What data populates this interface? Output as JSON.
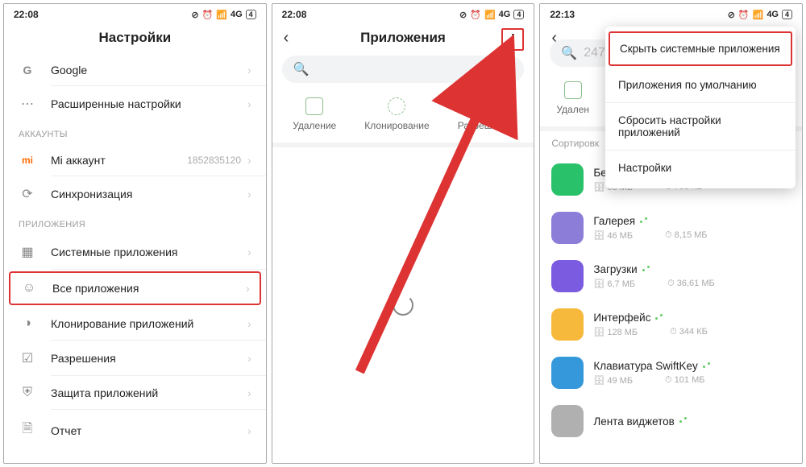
{
  "screen1": {
    "time": "22:08",
    "net": "4G",
    "batt": "4",
    "title": "Настройки",
    "rows": {
      "google": "Google",
      "advanced": "Расширенные настройки"
    },
    "section_accounts": "АККАУНТЫ",
    "mi_account": "Mi аккаунт",
    "mi_id": "1852835120",
    "sync": "Синхронизация",
    "section_apps": "ПРИЛОЖЕНИЯ",
    "sys_apps": "Системные приложения",
    "all_apps": "Все приложения",
    "clone_apps": "Клонирование приложений",
    "permissions": "Разрешения",
    "app_protect": "Защита приложений",
    "report": "Отчет"
  },
  "screen2": {
    "time": "22:08",
    "net": "4G",
    "batt": "4",
    "title": "Приложения",
    "actions": {
      "delete": "Удаление",
      "clone": "Клонирование",
      "perm": "Разрешения"
    }
  },
  "screen3": {
    "time": "22:13",
    "net": "4G",
    "batt": "4",
    "search_count": "247",
    "action_delete": "Удален",
    "sort_label": "Сортировк",
    "menu": {
      "hide_sys": "Скрыть системные приложения",
      "default_apps": "Приложения по умолчанию",
      "reset": "Сбросить настройки приложений",
      "settings": "Настройки"
    },
    "apps": [
      {
        "name": "Безопасность",
        "size": "68 МБ",
        "cache": "799 КБ",
        "iconClass": "bg-green"
      },
      {
        "name": "Галерея",
        "size": "46 МБ",
        "cache": "8,15 МБ",
        "iconClass": "bg-purple"
      },
      {
        "name": "Загрузки",
        "size": "6,7 МБ",
        "cache": "36,61 МБ",
        "iconClass": "bg-violet"
      },
      {
        "name": "Интерфейс",
        "size": "128 МБ",
        "cache": "344 КБ",
        "iconClass": "bg-orange"
      },
      {
        "name": "Клавиатура SwiftKey",
        "size": "49 МБ",
        "cache": "101 МБ",
        "iconClass": "bg-blue"
      },
      {
        "name": "Лента виджетов",
        "size": "",
        "cache": "",
        "iconClass": "bg-grey"
      }
    ]
  }
}
